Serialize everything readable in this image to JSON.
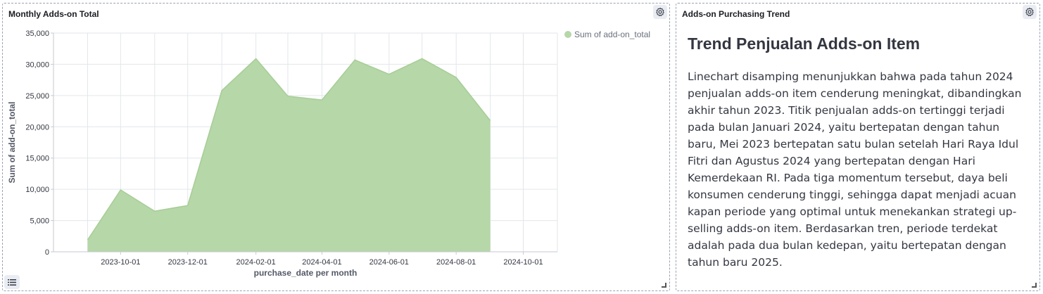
{
  "panels": {
    "chart": {
      "title": "Monthly Adds-on Total"
    },
    "text": {
      "title": "Adds-on Purchasing Trend",
      "heading": "Trend Penjualan Adds-on Item",
      "body": "Linechart disamping menunjukkan bahwa pada tahun 2024 penjualan adds-on item cenderung meningkat, dibandingkan akhir tahun 2023. Titik penjualan adds-on tertinggi terjadi pada bulan Januari 2024, yaitu bertepatan dengan tahun baru, Mei 2023 bertepatan satu bulan setelah Hari Raya Idul Fitri dan Agustus 2024 yang bertepatan dengan Hari Kemerdekaan RI. Pada tiga momentum tersebut, daya beli konsumen cenderung tinggi, sehingga dapat menjadi acuan kapan periode yang optimal untuk menekankan strategi up-selling adds-on item. Berdasarkan tren, periode terdekat adalah pada dua bulan kedepan, yaitu bertepatan dengan tahun baru 2025."
    }
  },
  "icons": {
    "settings": "gear-icon",
    "legend_toggle": "list-icon",
    "resize": "resize-handle-icon"
  },
  "colors": {
    "area_fill": "#b6d7a8",
    "area_stroke": "#a7cd97",
    "grid": "#e3e6ea"
  },
  "chart_data": {
    "type": "area",
    "xlabel": "purchase_date per month",
    "ylabel": "Sum of add-on_total",
    "ylim": [
      0,
      35000
    ],
    "yticks": [
      0,
      5000,
      10000,
      15000,
      20000,
      25000,
      30000,
      35000
    ],
    "ytick_labels": [
      "0",
      "5,000",
      "10,000",
      "15,000",
      "20,000",
      "25,000",
      "30,000",
      "35,000"
    ],
    "xlim": [
      "2023-08-01",
      "2024-11-01"
    ],
    "xticks": [
      "2023-10-01",
      "2023-12-01",
      "2024-02-01",
      "2024-04-01",
      "2024-06-01",
      "2024-08-01",
      "2024-10-01"
    ],
    "grid": true,
    "legend_position": "top-right",
    "series": [
      {
        "name": "Sum of add-on_total",
        "x": [
          "2023-09-01",
          "2023-10-01",
          "2023-11-01",
          "2023-12-01",
          "2024-01-01",
          "2024-02-01",
          "2024-03-01",
          "2024-04-01",
          "2024-05-01",
          "2024-06-01",
          "2024-07-01",
          "2024-08-01",
          "2024-09-01"
        ],
        "values": [
          1900,
          9900,
          6500,
          7400,
          25800,
          30900,
          24900,
          24300,
          30700,
          28400,
          30900,
          27900,
          21000
        ]
      }
    ]
  }
}
